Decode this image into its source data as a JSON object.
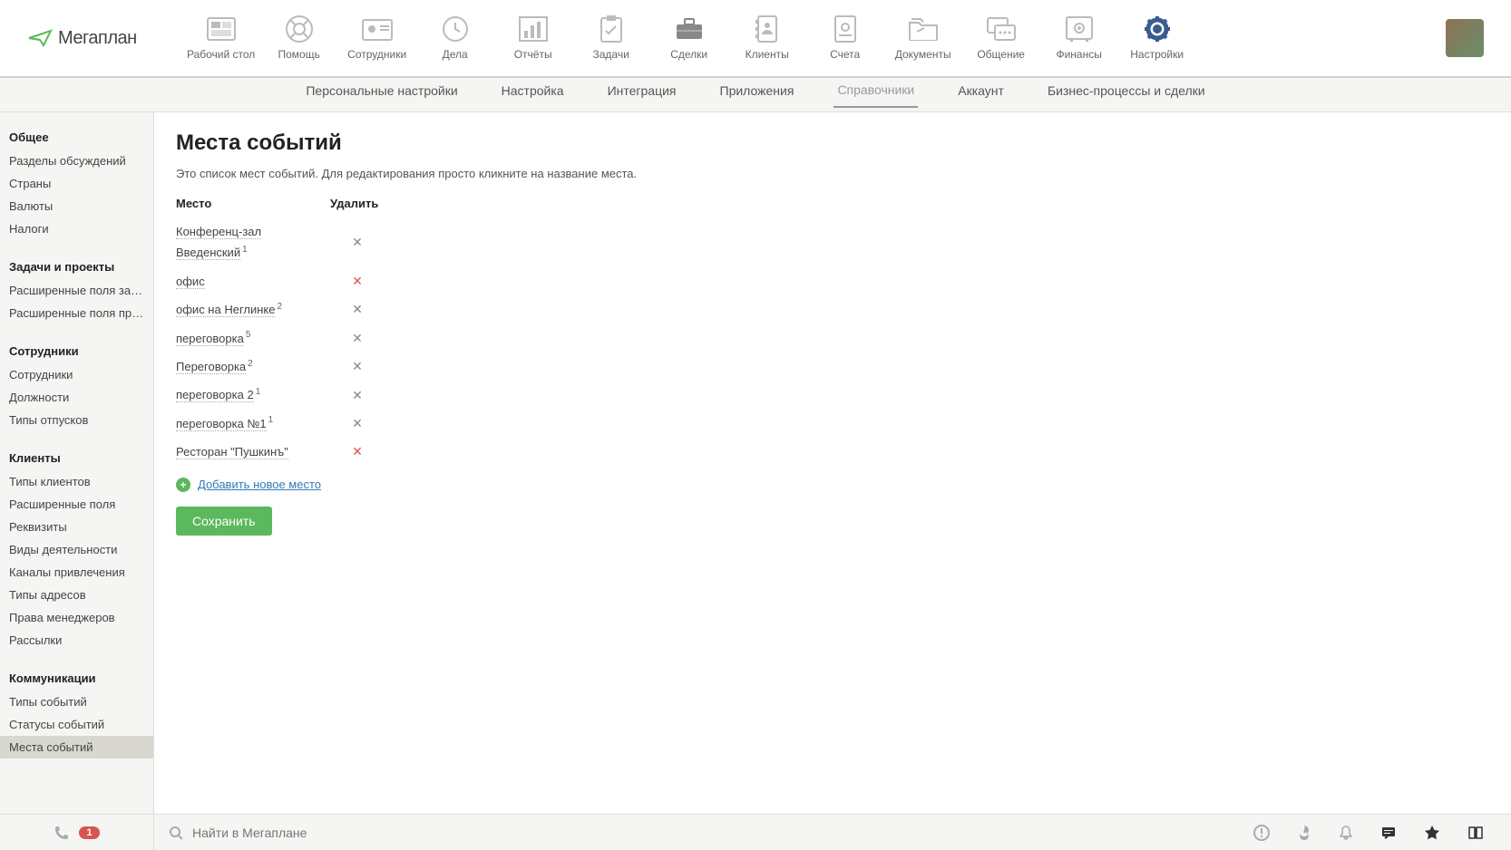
{
  "logo": {
    "text": "Мегаплан"
  },
  "topnav": [
    {
      "label": "Рабочий стол"
    },
    {
      "label": "Помощь"
    },
    {
      "label": "Сотрудники"
    },
    {
      "label": "Дела"
    },
    {
      "label": "Отчёты"
    },
    {
      "label": "Задачи"
    },
    {
      "label": "Сделки"
    },
    {
      "label": "Клиенты"
    },
    {
      "label": "Счета"
    },
    {
      "label": "Документы"
    },
    {
      "label": "Общение"
    },
    {
      "label": "Финансы"
    },
    {
      "label": "Настройки"
    }
  ],
  "subnav": [
    {
      "label": "Персональные настройки"
    },
    {
      "label": "Настройка"
    },
    {
      "label": "Интеграция"
    },
    {
      "label": "Приложения"
    },
    {
      "label": "Справочники"
    },
    {
      "label": "Аккаунт"
    },
    {
      "label": "Бизнес-процессы и сделки"
    }
  ],
  "sidebar": {
    "sections": [
      {
        "heading": "Общее",
        "items": [
          "Разделы обсуждений",
          "Страны",
          "Валюты",
          "Налоги"
        ]
      },
      {
        "heading": "Задачи и проекты",
        "items": [
          "Расширенные поля задач",
          "Расширенные поля проек…"
        ]
      },
      {
        "heading": "Сотрудники",
        "items": [
          "Сотрудники",
          "Должности",
          "Типы отпусков"
        ]
      },
      {
        "heading": "Клиенты",
        "items": [
          "Типы клиентов",
          "Расширенные поля",
          "Реквизиты",
          "Виды деятельности",
          "Каналы привлечения",
          "Типы адресов",
          "Права менеджеров",
          "Рассылки"
        ]
      },
      {
        "heading": "Коммуникации",
        "items": [
          "Типы событий",
          "Статусы событий",
          "Места событий"
        ]
      }
    ],
    "active": "Места событий"
  },
  "page": {
    "title": "Места событий",
    "desc": "Это список мест событий. Для редактирования просто кликните на название места.",
    "col_place": "Место",
    "col_delete": "Удалить",
    "places": [
      {
        "name": "Конференц-зал Введенский",
        "sup": "1",
        "red": false
      },
      {
        "name": "офис",
        "sup": "",
        "red": true
      },
      {
        "name": "офис на Неглинке",
        "sup": "2",
        "red": false
      },
      {
        "name": "переговорка",
        "sup": "5",
        "red": false
      },
      {
        "name": "Переговорка",
        "sup": "2",
        "red": false
      },
      {
        "name": "переговорка 2",
        "sup": "1",
        "red": false
      },
      {
        "name": "переговорка №1",
        "sup": "1",
        "red": false
      },
      {
        "name": "Ресторан \"Пушкинъ\"",
        "sup": "",
        "red": true
      }
    ],
    "add_label": "Добавить новое место",
    "save_label": "Сохранить"
  },
  "bottombar": {
    "badge": "1",
    "search_placeholder": "Найти в Мегаплане"
  }
}
